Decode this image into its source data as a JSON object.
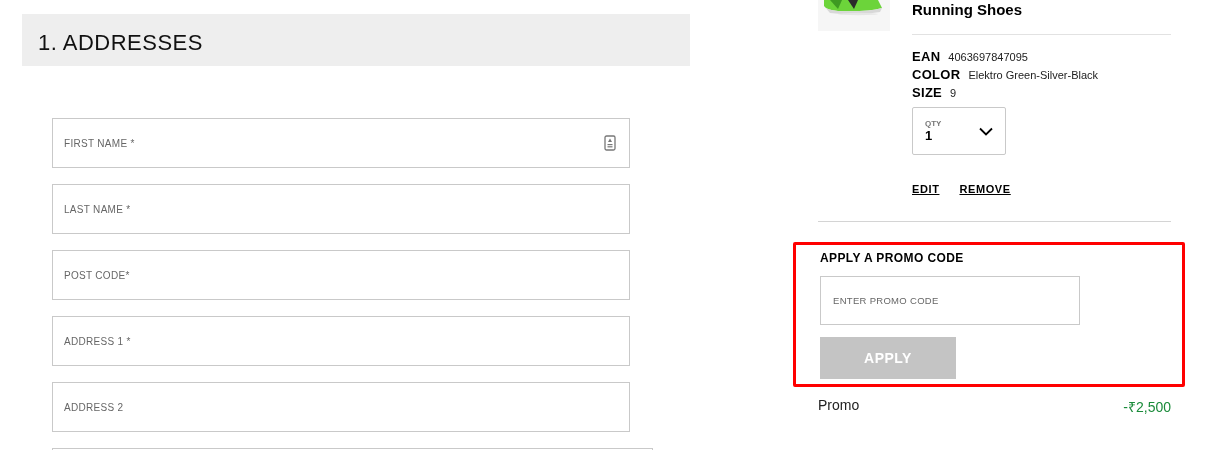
{
  "section": {
    "title": "1. ADDRESSES"
  },
  "fields": [
    {
      "placeholder": "FIRST NAME *",
      "kind": "contact"
    },
    {
      "placeholder": "LAST NAME *",
      "kind": "text"
    },
    {
      "placeholder": "POST CODE*",
      "kind": "text"
    },
    {
      "placeholder": "ADDRESS 1 *",
      "kind": "text"
    },
    {
      "placeholder": "ADDRESS 2",
      "kind": "text"
    }
  ],
  "product": {
    "image": {
      "kind": "picture"
    },
    "name": "Running Shoes",
    "details": [
      {
        "label": "EAN",
        "value": "4063697847095"
      },
      {
        "label": "COLOR",
        "value": "Elektro Green-Silver-Black"
      },
      {
        "label": "SIZE",
        "value": "9"
      }
    ],
    "qty": {
      "label": "QTY",
      "value": "1"
    },
    "actions": [
      "EDIT",
      "REMOVE"
    ]
  },
  "promo": {
    "highlighted": true,
    "title": "APPLY A PROMO CODE",
    "placeholder": "ENTER PROMO CODE",
    "button": {
      "label": "APPLY",
      "disabled": true
    }
  },
  "summary": [
    {
      "label": "Promo",
      "value": "-₹2,500"
    }
  ]
}
